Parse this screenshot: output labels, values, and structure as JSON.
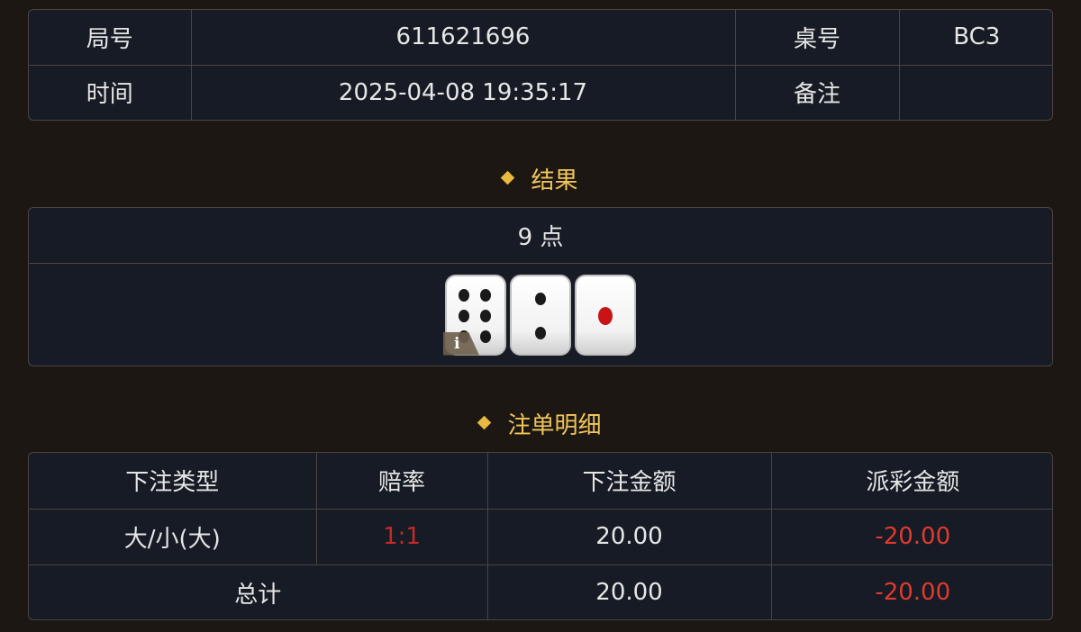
{
  "info": {
    "round_label": "局号",
    "round_value": "611621696",
    "table_label": "桌号",
    "table_value": "BC3",
    "time_label": "时间",
    "time_value": "2025-04-08 19:35:17",
    "note_label": "备注",
    "note_value": ""
  },
  "result": {
    "title": "结果",
    "points": "9 点",
    "dice": [
      6,
      2,
      1
    ],
    "info_badge": "i"
  },
  "bets": {
    "title": "注单明细",
    "headers": [
      "下注类型",
      "赔率",
      "下注金额",
      "派彩金额"
    ],
    "rows": [
      {
        "type": "大/小(大)",
        "odds": "1:1",
        "amount": "20.00",
        "payout": "-20.00"
      }
    ],
    "total": {
      "label": "总计",
      "amount": "20.00",
      "payout": "-20.00"
    }
  },
  "colors": {
    "accent": "#f0c55a",
    "negative": "#e03a2e",
    "panel_bg": "#161b25",
    "page_bg": "#1c1712"
  }
}
